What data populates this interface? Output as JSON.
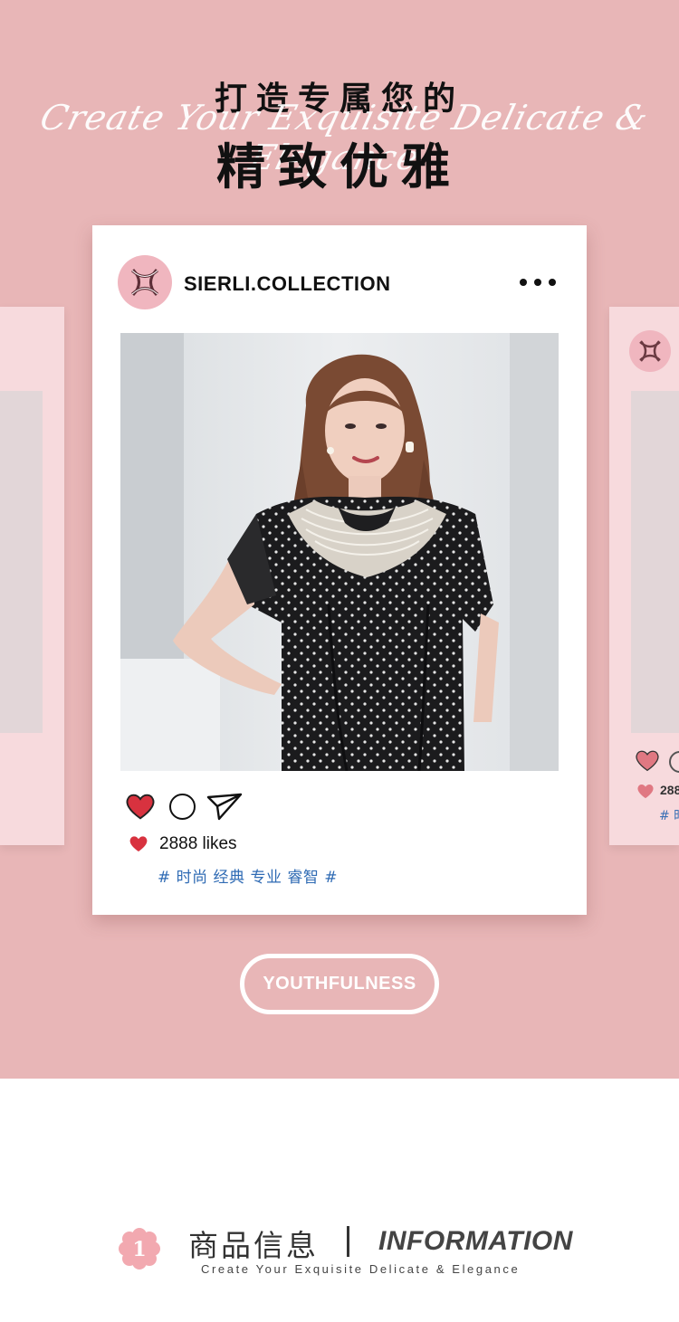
{
  "header": {
    "title_cn_line1": "打造专属您的",
    "script_en": "Create Your Exquisite Delicate & Elegance",
    "title_cn_line2": "精致优雅"
  },
  "post": {
    "handle": "SIERLI.COLLECTION",
    "more_icon": "more-horizontal-icon",
    "likes": "2888 likes",
    "tags": "# 时尚 经典 专业 睿智 #"
  },
  "ghost_card_right": {
    "likes_partial": "288",
    "tags_partial": "# 时"
  },
  "pill": {
    "label": "YOUTHFULNESS"
  },
  "footer": {
    "badge_number": "1",
    "title_cn": "商品信息",
    "title_en": "INFORMATION",
    "subtitle": "Create Your Exquisite Delicate & Elegance"
  },
  "colors": {
    "background_pink": "#e8b6b7",
    "ghost_card": "#f7dadd",
    "heart_red": "#d8323f",
    "tag_blue": "#2f6bb4",
    "avatar_pink": "#f0b6bf"
  }
}
